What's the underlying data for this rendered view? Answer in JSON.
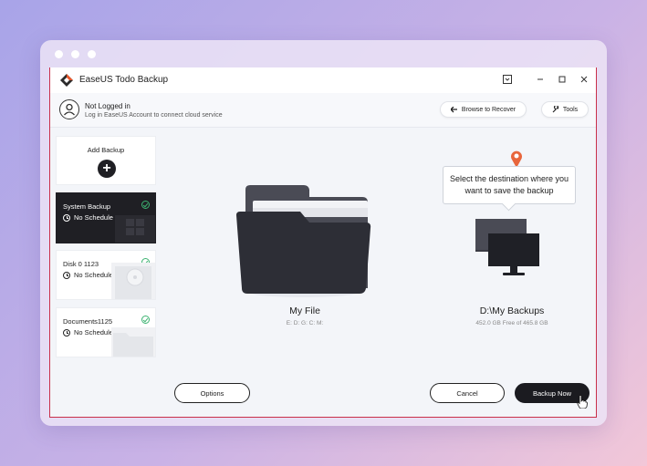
{
  "app": {
    "title": "EaseUS Todo Backup",
    "accent_color": "#c9304a"
  },
  "account": {
    "title": "Not Logged in",
    "subtitle": "Log in EaseUS Account to connect cloud service"
  },
  "toolbar": {
    "browse_label": "Browse to Recover",
    "tools_label": "Tools"
  },
  "sidebar": {
    "add_label": "Add Backup",
    "items": [
      {
        "title": "System Backup",
        "schedule": "No Schedule",
        "status": "check-icon",
        "selected": true
      },
      {
        "title": "Disk 0 1123",
        "schedule": "No Schedule",
        "status": "check-icon",
        "selected": false
      },
      {
        "title": "Documents1125",
        "schedule": "No Schedule",
        "status": "check-icon",
        "selected": false
      }
    ]
  },
  "source": {
    "label": "My File",
    "drives": "E: D: G: C: M:"
  },
  "destination": {
    "callout": "Select the destination where you want to save the backup",
    "label": "D:\\My Backups",
    "free": "452.0 GB Free of 465.8 GB"
  },
  "actions": {
    "options_label": "Options",
    "cancel_label": "Cancel",
    "backup_label": "Backup Now"
  }
}
